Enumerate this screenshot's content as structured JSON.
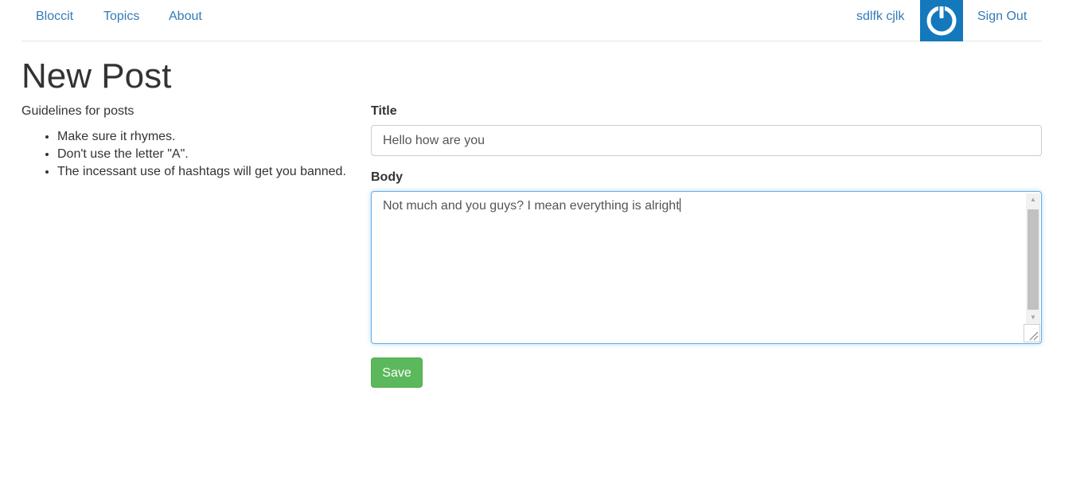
{
  "nav": {
    "brand": "Bloccit",
    "topics": "Topics",
    "about": "About",
    "user_name": "sdlfk cjlk",
    "sign_out": "Sign Out",
    "avatar_icon": "power-icon"
  },
  "page": {
    "title": "New Post"
  },
  "guidelines": {
    "heading": "Guidelines for posts",
    "items": [
      "Make sure it rhymes.",
      "Don't use the letter \"A\".",
      "The incessant use of hashtags will get you banned."
    ]
  },
  "form": {
    "title_label": "Title",
    "title_value": "Hello how are you",
    "body_label": "Body",
    "body_value": "Not much and you guys? I mean everything is alright",
    "save_label": "Save"
  },
  "colors": {
    "link": "#337ab7",
    "avatar_bg": "#1478bd",
    "save_bg": "#5cb85c",
    "focus_border": "#66afe9"
  }
}
